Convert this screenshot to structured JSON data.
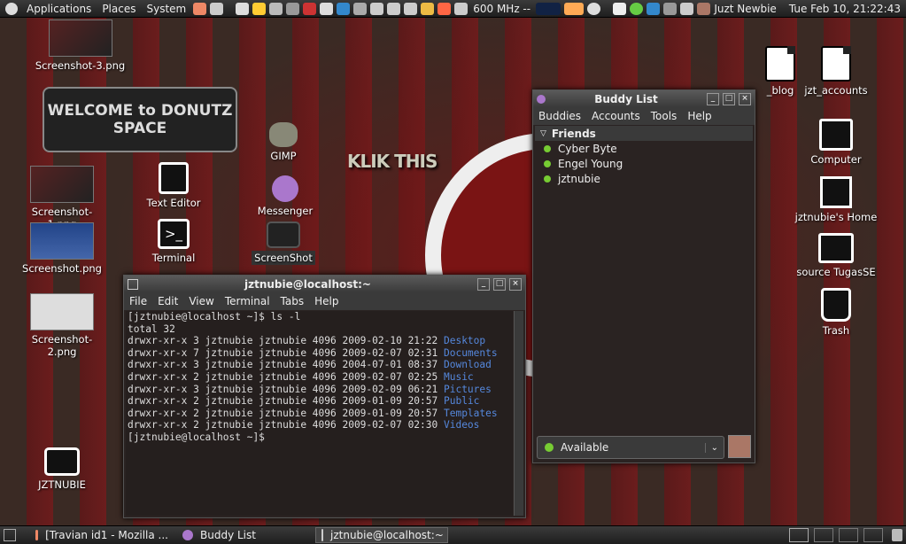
{
  "topbar": {
    "menus": [
      "Applications",
      "Places",
      "System"
    ],
    "cpu": "600 MHz --",
    "user": "Juzt Newbie",
    "clock": "Tue Feb 10, 21:22:43"
  },
  "desktop": {
    "left_icons": [
      {
        "label": "Screenshot-3.png"
      },
      {
        "label": "Screenshot-1.png"
      },
      {
        "label": "Screenshot.png"
      },
      {
        "label": "Screenshot-2.png"
      },
      {
        "label": "JZTNUBIE"
      }
    ],
    "mid_icons": [
      {
        "label": "GIMP"
      },
      {
        "label": "Text Editor"
      },
      {
        "label": "Messenger"
      },
      {
        "label": "Terminal"
      },
      {
        "label": "ScreenShot"
      }
    ],
    "right_icons": [
      {
        "label": "_blog"
      },
      {
        "label": "jzt_accounts"
      },
      {
        "label": "Computer"
      },
      {
        "label": "jztnubie's Home"
      },
      {
        "label": "source TugasSE"
      },
      {
        "label": "Trash"
      }
    ],
    "banner": "WELCOME to DONUTZ SPACE",
    "klik": "KLIK THIS"
  },
  "buddy": {
    "title": "Buddy List",
    "menus": [
      "Buddies",
      "Accounts",
      "Tools",
      "Help"
    ],
    "group": "Friends",
    "buddies": [
      "Cyber Byte",
      "Engel Young",
      "jztnubie"
    ],
    "status": "Available"
  },
  "terminal": {
    "title": "jztnubie@localhost:~",
    "menus": [
      "File",
      "Edit",
      "View",
      "Terminal",
      "Tabs",
      "Help"
    ],
    "prompt": "[jztnubie@localhost ~]$ ls -l",
    "total": "total 32",
    "rows": [
      {
        "perm": "drwxr-xr-x 3 jztnubie jztnubie 4096 2009-02-10 21:22 ",
        "name": "Desktop"
      },
      {
        "perm": "drwxr-xr-x 7 jztnubie jztnubie 4096 2009-02-07 02:31 ",
        "name": "Documents"
      },
      {
        "perm": "drwxr-xr-x 3 jztnubie jztnubie 4096 2004-07-01 08:37 ",
        "name": "Download"
      },
      {
        "perm": "drwxr-xr-x 2 jztnubie jztnubie 4096 2009-02-07 02:25 ",
        "name": "Music"
      },
      {
        "perm": "drwxr-xr-x 3 jztnubie jztnubie 4096 2009-02-09 06:21 ",
        "name": "Pictures"
      },
      {
        "perm": "drwxr-xr-x 2 jztnubie jztnubie 4096 2009-01-09 20:57 ",
        "name": "Public"
      },
      {
        "perm": "drwxr-xr-x 2 jztnubie jztnubie 4096 2009-01-09 20:57 ",
        "name": "Templates"
      },
      {
        "perm": "drwxr-xr-x 2 jztnubie jztnubie 4096 2009-02-07 02:30 ",
        "name": "Videos"
      }
    ],
    "prompt2": "[jztnubie@localhost ~]$"
  },
  "taskbar": {
    "items": [
      "[Travian id1 - Mozilla ...",
      "Buddy List",
      "jztnubie@localhost:~"
    ]
  }
}
